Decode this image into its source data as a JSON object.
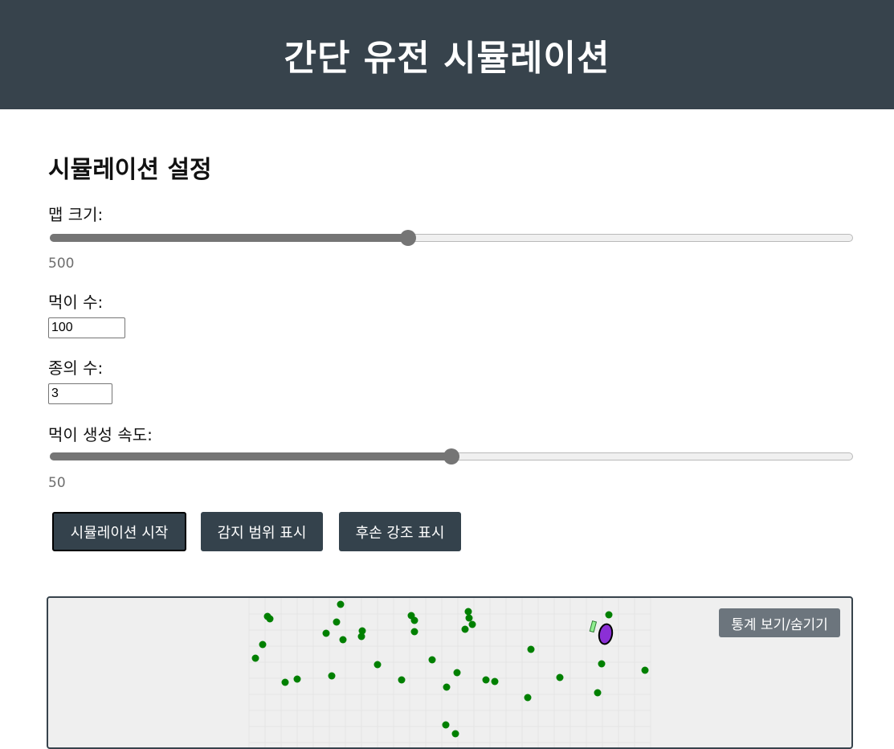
{
  "header": {
    "title": "간단 유전 시뮬레이션"
  },
  "settings": {
    "heading": "시뮬레이션 설정",
    "map_size": {
      "label": "맵 크기:",
      "value": "500",
      "fraction": 0.446
    },
    "food_count": {
      "label": "먹이 수:",
      "value": "100"
    },
    "species_count": {
      "label": "종의 수:",
      "value": "3"
    },
    "food_rate": {
      "label": "먹이 생성 속도:",
      "value": "50",
      "fraction": 0.5
    }
  },
  "buttons": {
    "start": "시뮬레이션 시작",
    "show_range": "감지 범위 표시",
    "highlight_offspring": "후손 강조 표시"
  },
  "simulation": {
    "stats_toggle": "통계 보기/숨기기",
    "colors": {
      "background": "#efefef",
      "grid": "#e4e4e4",
      "food": "#008000",
      "creature": "#8b2fd6",
      "creature_outline": "#000000",
      "indicator": "#90ee90"
    }
  }
}
